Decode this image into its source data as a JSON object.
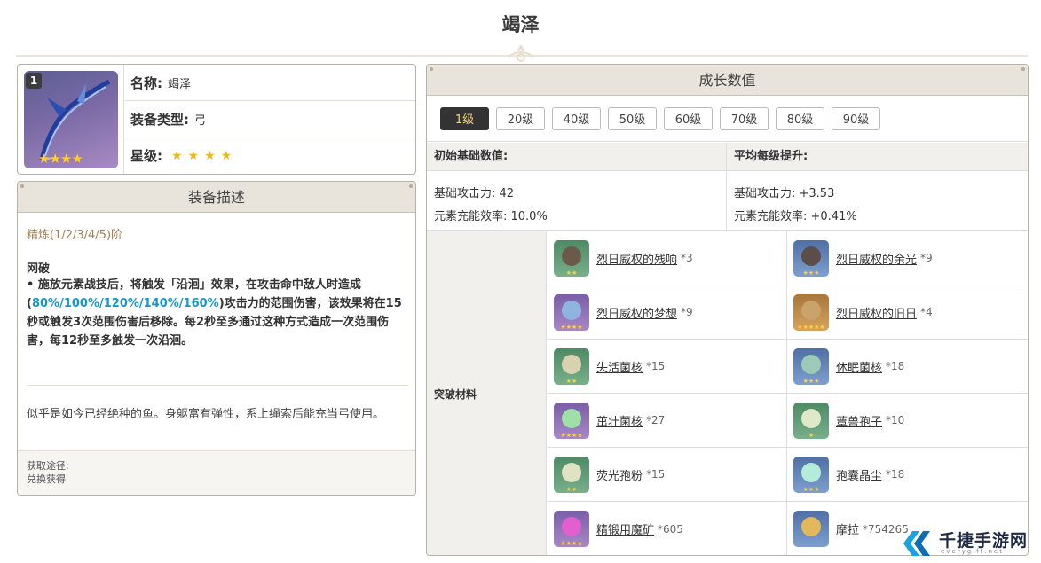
{
  "page": {
    "title": "竭泽"
  },
  "info": {
    "refine_badge": "1",
    "name_key": "名称:",
    "name_val": "竭泽",
    "type_key": "装备类型:",
    "type_val": "弓",
    "rarity_key": "星级:",
    "rarity_stars": "★★★★",
    "card_stars": "★★★★"
  },
  "desc": {
    "header": "装备描述",
    "refine": "精炼(1/2/3/4/5)阶",
    "skill_name": "网破",
    "skill_prefix": "• 施放元素战技后，将触发「沿洄」效果，在攻击命中敌人时造成(",
    "skill_highlight": "80%/100%/120%/140%/160%",
    "skill_suffix": ")攻击力的范围伤害，该效果将在15秒或触发3次范围伤害后移除。每2秒至多通过这种方式造成一次范围伤害，每12秒至多触发一次沿洄。",
    "flavor": "似乎是如今已经绝种的鱼。身躯富有弹性，系上绳索后能充当弓使用。",
    "source_label": "获取途径:",
    "source_val": "兑换获得"
  },
  "growth": {
    "header": "成长数值",
    "levels": [
      "1级",
      "20级",
      "40级",
      "50级",
      "60级",
      "70级",
      "80级",
      "90级"
    ],
    "active_level": "1级",
    "base_head": "初始基础数值:",
    "growth_head": "平均每级提升:",
    "base_atk": "基础攻击力: 42",
    "base_er": "元素充能效率: 10.0%",
    "inc_atk": "基础攻击力: +3.53",
    "inc_er": "元素充能效率: +0.41%",
    "materials_label": "突破材料",
    "materials": [
      {
        "name": "烈日威权的残响",
        "count": "*3",
        "stars": "★★",
        "rarity": "r2",
        "core": "#6b5a4a"
      },
      {
        "name": "烈日威权的余光",
        "count": "*9",
        "stars": "★★★",
        "rarity": "r3",
        "core": "#5b4d47"
      },
      {
        "name": "烈日威权的梦想",
        "count": "*9",
        "stars": "★★★★",
        "rarity": "r4",
        "core": "#8fb4e0"
      },
      {
        "name": "烈日威权的旧日",
        "count": "*4",
        "stars": "★★★★★",
        "rarity": "r5",
        "core": "#c9a36c"
      },
      {
        "name": "失活菌核",
        "count": "*15",
        "stars": "★★",
        "rarity": "r2",
        "core": "#d8d2b0"
      },
      {
        "name": "休眠菌核",
        "count": "*18",
        "stars": "★★★",
        "rarity": "r3",
        "core": "#9cc9b8"
      },
      {
        "name": "茁壮菌核",
        "count": "*27",
        "stars": "★★★★",
        "rarity": "r4",
        "core": "#9ee0a8"
      },
      {
        "name": "蕈兽孢子",
        "count": "*10",
        "stars": "★",
        "rarity": "r2",
        "core": "#dfe8c8"
      },
      {
        "name": "荧光孢粉",
        "count": "*15",
        "stars": "★★",
        "rarity": "r2",
        "core": "#dfe2c3"
      },
      {
        "name": "孢囊晶尘",
        "count": "*18",
        "stars": "★★★",
        "rarity": "r3",
        "core": "#b5ecd9"
      },
      {
        "name": "精锻用魔矿",
        "count": "*605",
        "stars": "★★★★",
        "rarity": "r4",
        "core": "#e25fcf"
      },
      {
        "name": "摩拉",
        "count": "*754265",
        "stars": "",
        "rarity": "r3",
        "core": "#e3b85a",
        "plain": true
      }
    ]
  },
  "watermark": {
    "text": "千捷手游网",
    "sub": "everygift.net"
  },
  "colors": {
    "accent_gold": "#f1d17e",
    "highlight_blue": "#1a96c5",
    "refine_brown": "#a37f56"
  }
}
